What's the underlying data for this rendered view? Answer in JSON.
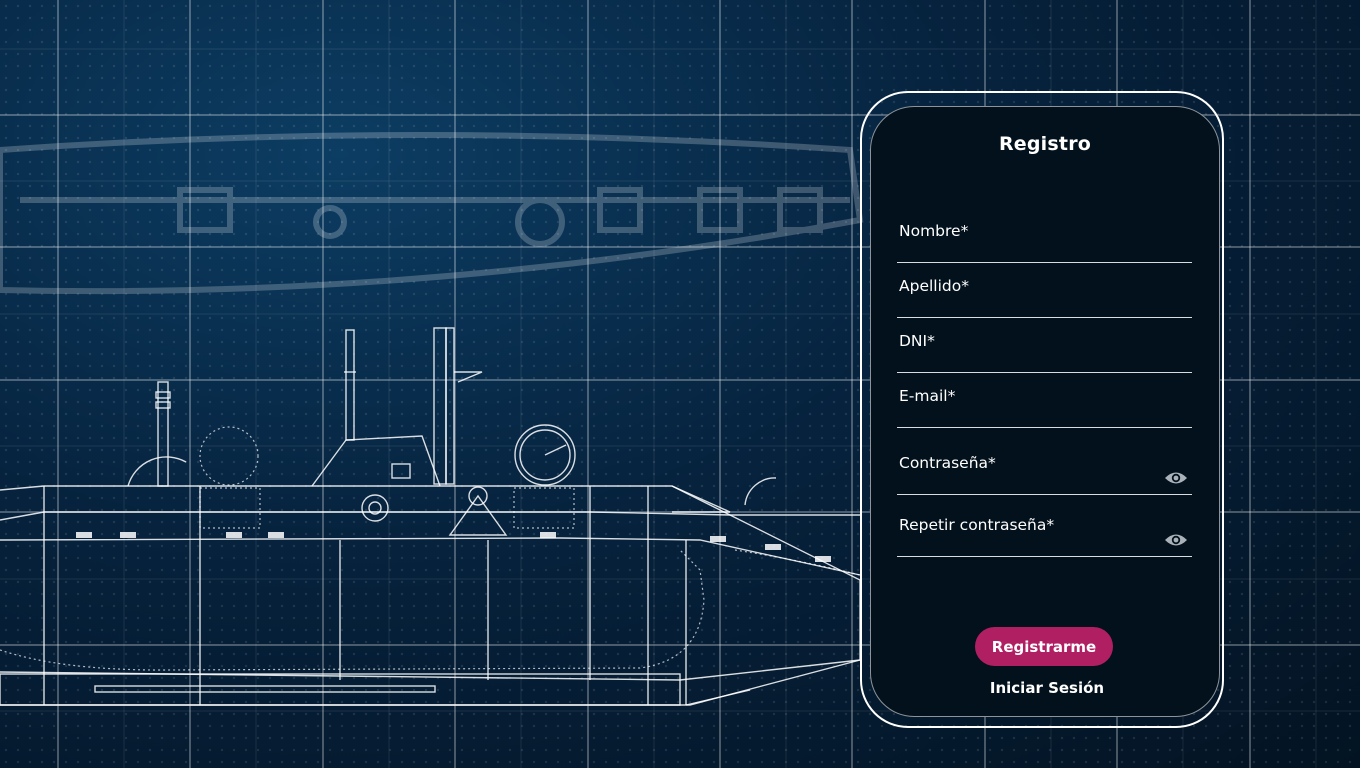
{
  "form": {
    "title": "Registro",
    "fields": {
      "nombre": "Nombre*",
      "apellido": "Apellido*",
      "dni": "DNI*",
      "email": "E-mail*",
      "password": "Contraseña*",
      "repeat_password": "Repetir contraseña*"
    },
    "submit_label": "Registrarme",
    "login_link": "Iniciar Sesión"
  },
  "icons": {
    "password_toggle": "eye-icon"
  },
  "colors": {
    "primary_button": "#b11f63",
    "card_background": "#03111c",
    "background_blueprint": "#06223d"
  }
}
